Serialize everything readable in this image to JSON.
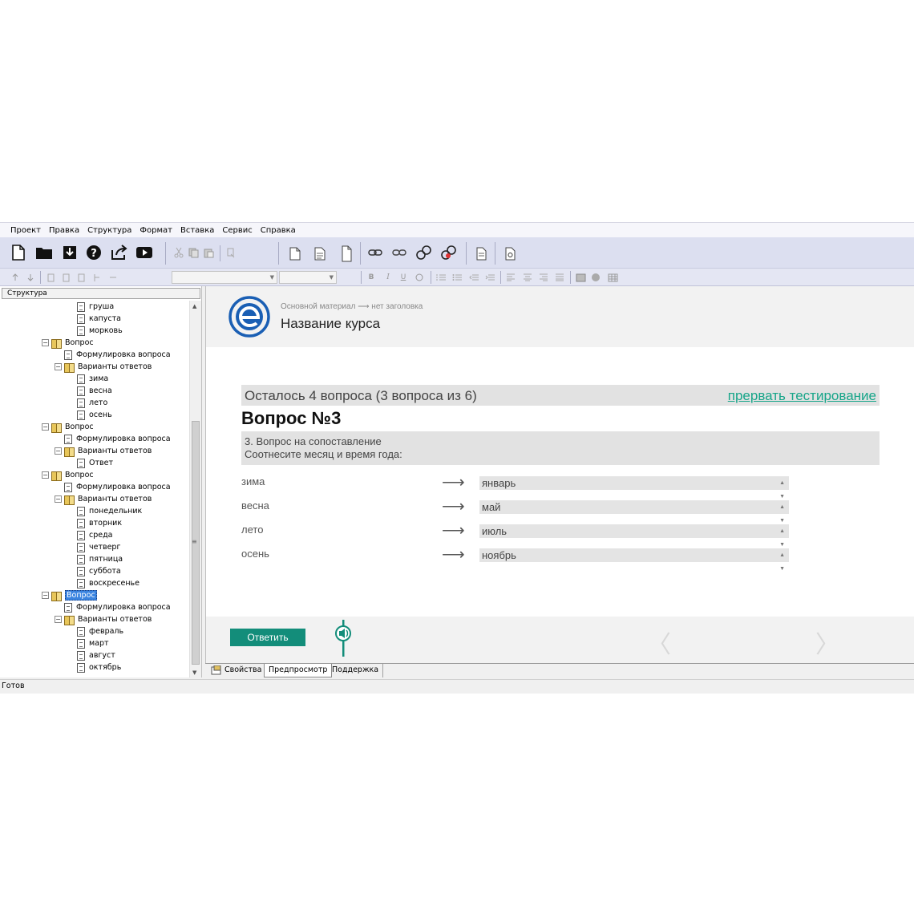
{
  "menu": [
    "Проект",
    "Правка",
    "Структура",
    "Формат",
    "Вставка",
    "Сервис",
    "Справка"
  ],
  "left_panel": {
    "header": "Структура",
    "tree": [
      {
        "label": "груша",
        "level": 3,
        "icon": "doc"
      },
      {
        "label": "капуста",
        "level": 3,
        "icon": "doc"
      },
      {
        "label": "морковь",
        "level": 3,
        "icon": "doc"
      },
      {
        "label": "Вопрос",
        "level": 1,
        "icon": "book",
        "expander": "−"
      },
      {
        "label": "Формулировка вопроса",
        "level": 2,
        "icon": "doc"
      },
      {
        "label": "Варианты ответов",
        "level": 2,
        "icon": "book",
        "expander": "−"
      },
      {
        "label": "зима",
        "level": 3,
        "icon": "doc"
      },
      {
        "label": "весна",
        "level": 3,
        "icon": "doc"
      },
      {
        "label": "лето",
        "level": 3,
        "icon": "doc"
      },
      {
        "label": "осень",
        "level": 3,
        "icon": "doc"
      },
      {
        "label": "Вопрос",
        "level": 1,
        "icon": "book",
        "expander": "−"
      },
      {
        "label": "Формулировка вопроса",
        "level": 2,
        "icon": "doc"
      },
      {
        "label": "Варианты ответов",
        "level": 2,
        "icon": "book",
        "expander": "−"
      },
      {
        "label": "Ответ",
        "level": 3,
        "icon": "doc"
      },
      {
        "label": "Вопрос",
        "level": 1,
        "icon": "book",
        "expander": "−"
      },
      {
        "label": "Формулировка вопроса",
        "level": 2,
        "icon": "doc"
      },
      {
        "label": "Варианты ответов",
        "level": 2,
        "icon": "book",
        "expander": "−"
      },
      {
        "label": "понедельник",
        "level": 3,
        "icon": "doc"
      },
      {
        "label": "вторник",
        "level": 3,
        "icon": "doc"
      },
      {
        "label": "среда",
        "level": 3,
        "icon": "doc"
      },
      {
        "label": "четверг",
        "level": 3,
        "icon": "doc"
      },
      {
        "label": "пятница",
        "level": 3,
        "icon": "doc"
      },
      {
        "label": "суббота",
        "level": 3,
        "icon": "doc"
      },
      {
        "label": "воскресенье",
        "level": 3,
        "icon": "doc"
      },
      {
        "label": "Вопрос",
        "level": 1,
        "icon": "book",
        "expander": "−",
        "selected": true
      },
      {
        "label": "Формулировка вопроса",
        "level": 2,
        "icon": "doc"
      },
      {
        "label": "Варианты ответов",
        "level": 2,
        "icon": "book",
        "expander": "−"
      },
      {
        "label": "февраль",
        "level": 3,
        "icon": "doc"
      },
      {
        "label": "март",
        "level": 3,
        "icon": "doc"
      },
      {
        "label": "август",
        "level": 3,
        "icon": "doc"
      },
      {
        "label": "октябрь",
        "level": 3,
        "icon": "doc"
      }
    ]
  },
  "preview": {
    "breadcrumb": "Основной материал ⟶ нет заголовка",
    "course_title": "Название курса",
    "remaining": "Осталось 4 вопроса (3 вопроса из 6)",
    "abort_link": "прервать тестирование",
    "question_title": "Вопрос №3",
    "question_line1": "3. Вопрос на сопоставление",
    "question_line2": "Соотнесите месяц и время года:",
    "arrow_glyph": "⟶",
    "matches": [
      {
        "left": "зима",
        "right": "январь"
      },
      {
        "left": "весна",
        "right": "май"
      },
      {
        "left": "лето",
        "right": "июль"
      },
      {
        "left": "осень",
        "right": "ноябрь"
      }
    ],
    "answer_button": "Ответить",
    "prev_glyph": "〈",
    "next_glyph": "〉",
    "accent_color": "#138d7a",
    "link_color": "#17a589",
    "logo_color": "#1a5fb4"
  },
  "tabs": [
    {
      "label": "Свойства",
      "active": false
    },
    {
      "label": "Предпросмотр",
      "active": true
    },
    {
      "label": "Поддержка",
      "active": false
    }
  ],
  "statusbar": "Готов"
}
